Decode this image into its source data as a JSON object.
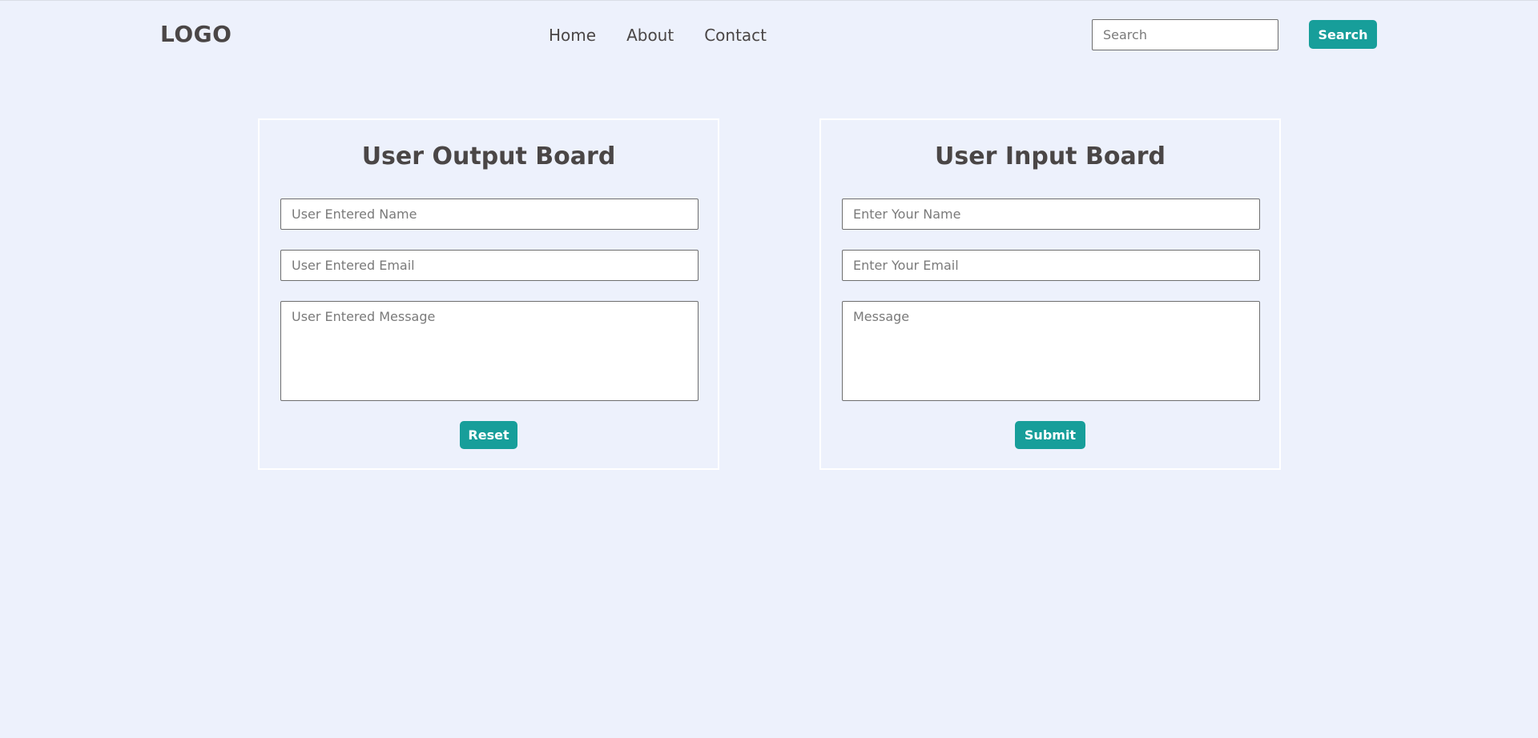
{
  "header": {
    "logo": "LOGO",
    "nav": [
      "Home",
      "About",
      "Contact"
    ],
    "search_placeholder": "Search",
    "search_button": "Search"
  },
  "output_board": {
    "title": "User Output Board",
    "name_placeholder": "User Entered Name",
    "email_placeholder": "User Entered Email",
    "message_placeholder": "User Entered Message",
    "button": "Reset"
  },
  "input_board": {
    "title": "User Input Board",
    "name_placeholder": "Enter Your Name",
    "email_placeholder": "Enter Your Email",
    "message_placeholder": "Message",
    "button": "Submit"
  },
  "colors": {
    "background": "#edf1fc",
    "accent": "#179e9a",
    "text": "#4a4646"
  }
}
